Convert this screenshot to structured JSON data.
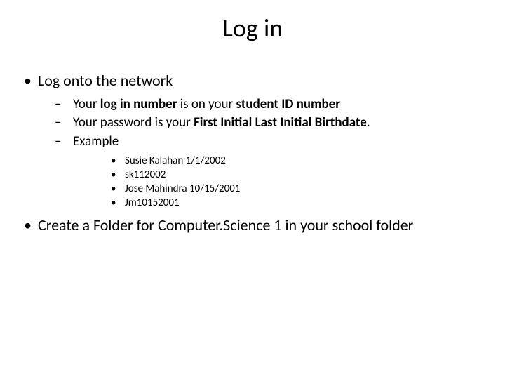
{
  "title": "Log in",
  "bullets": {
    "lvl1_0": "Log onto the network",
    "lvl1_1": "Create a Folder for Computer.Science 1 in your school folder",
    "lvl2_0_pre": "Your ",
    "lvl2_0_b1": "log in number ",
    "lvl2_0_mid": "is on your ",
    "lvl2_0_b2": "student ID number",
    "lvl2_1_pre": "Your password is your ",
    "lvl2_1_b1": "First Initial Last Initial Birthdate",
    "lvl2_1_post": ".",
    "lvl2_2": "Example",
    "lvl3_0": "Susie Kalahan 1/1/2002",
    "lvl3_1": "sk112002",
    "lvl3_2": "Jose Mahindra  10/15/2001",
    "lvl3_3": "Jm10152001"
  }
}
